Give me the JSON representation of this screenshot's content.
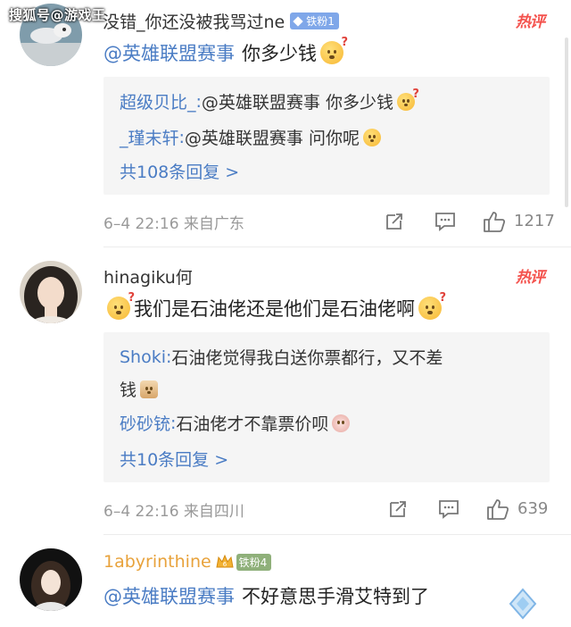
{
  "watermark": "搜狐号@游戏王",
  "comments": [
    {
      "username": "没错_你还没被我骂过ne",
      "fan_badge": "铁粉1",
      "hot_label": "热评",
      "mention": "@英雄联盟赛事",
      "text": "你多少钱",
      "replies": [
        {
          "name": "超级贝比_",
          "text": "@英雄联盟赛事 你多少钱"
        },
        {
          "name": "_瑾末轩",
          "text": "@英雄联盟赛事 问你呢"
        }
      ],
      "reply_total": "共108条回复 >",
      "meta": "6–4 22:16  来自广东",
      "likes": "1217"
    },
    {
      "username": "hinagiku何",
      "hot_label": "热评",
      "text": "我们是石油佬还是他们是石油佬啊",
      "replies": [
        {
          "name": "Shoki",
          "text": "石油佬觉得我白送你票都行，又不差",
          "text2": "钱"
        },
        {
          "name": "砂砂铳",
          "text": "石油佬才不靠票价呗"
        }
      ],
      "reply_total": "共10条回复 >",
      "meta": "6–4 22:16  来自四川",
      "likes": "639"
    },
    {
      "username": "1abyrinthine",
      "fan_badge": "铁粉4",
      "mention": "@英雄联盟赛事",
      "text": "不好意思手滑艾特到了"
    }
  ],
  "colors": {
    "link": "#4a7cc4",
    "hot": "#f4524d",
    "gold_name": "#e8a23b",
    "badge": "#7fa7e9"
  }
}
